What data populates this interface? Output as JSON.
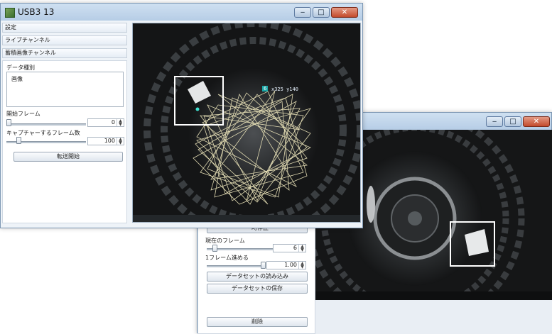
{
  "main_window": {
    "title": "USB3 13",
    "sections": [
      "設定",
      "ライブチャンネル",
      "蓄積画像チャンネル"
    ],
    "data_type_label": "データ種別",
    "data_list": [
      "画像"
    ],
    "start_frame_label": "開始フレーム",
    "start_frame_value": "0",
    "capture_count_label": "キャプチャーするフレーム数",
    "capture_count_value": "100",
    "transfer_button": "転送開始",
    "tracker": {
      "id_label": "6",
      "coords": "x325 y140"
    }
  },
  "second_window": {
    "pause_button": "一時停止",
    "current_frame_label": "現在のフレーム",
    "current_frame_value": "6",
    "step_label": "1フレーム進める",
    "step_value": "1.00",
    "load_button": "データセットの読み込み",
    "save_button": "データセットの保存",
    "delete_button": "削除"
  },
  "caption": {
    "minimize": "‒",
    "maximize": "□",
    "close": "✕"
  }
}
